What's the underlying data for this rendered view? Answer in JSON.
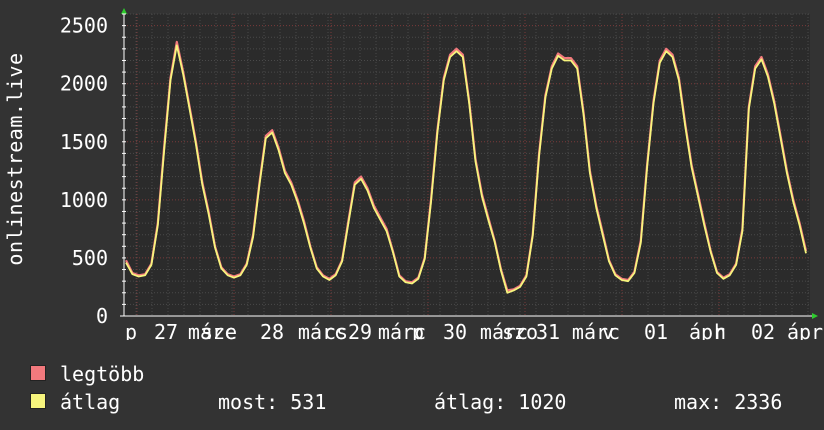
{
  "chart_data": {
    "type": "line",
    "ylabel": "onlinestream.live",
    "yticks": [
      0,
      500,
      1000,
      1500,
      2000,
      2500
    ],
    "ylim": [
      0,
      2600
    ],
    "x_tick_labels": [
      "p",
      "27",
      "márc",
      "sze",
      "28",
      "márc",
      "cs",
      "29",
      "márc",
      "p",
      "30",
      "márc",
      "szo",
      "31",
      "márc",
      "v",
      "01",
      "ápr",
      "h",
      "02",
      "ápr"
    ],
    "grid": true,
    "series": [
      {
        "name": "legtöbb",
        "color": "#f2797d",
        "values": [
          480,
          370,
          350,
          360,
          450,
          800,
          1450,
          2050,
          2360,
          2100,
          1800,
          1500,
          1150,
          900,
          600,
          420,
          360,
          340,
          360,
          450,
          700,
          1150,
          1550,
          1600,
          1450,
          1250,
          1150,
          1000,
          820,
          600,
          420,
          350,
          320,
          360,
          480,
          820,
          1150,
          1200,
          1100,
          950,
          850,
          750,
          560,
          350,
          300,
          290,
          330,
          500,
          1000,
          1600,
          2050,
          2250,
          2300,
          2250,
          1850,
          1350,
          1050,
          850,
          650,
          400,
          220,
          230,
          260,
          350,
          700,
          1400,
          1900,
          2150,
          2260,
          2220,
          2220,
          2150,
          1750,
          1250,
          950,
          720,
          480,
          360,
          320,
          310,
          380,
          650,
          1300,
          1850,
          2200,
          2300,
          2250,
          2050,
          1650,
          1300,
          1050,
          800,
          560,
          380,
          330,
          360,
          450,
          750,
          1800,
          2150,
          2230,
          2080,
          1850,
          1550,
          1250,
          1000,
          800,
          560
        ]
      },
      {
        "name": "átlag",
        "color": "#f7f57d",
        "values": [
          460,
          360,
          340,
          350,
          440,
          780,
          1420,
          2030,
          2330,
          2080,
          1780,
          1480,
          1130,
          880,
          590,
          410,
          350,
          330,
          350,
          440,
          680,
          1130,
          1530,
          1580,
          1430,
          1230,
          1130,
          980,
          800,
          590,
          410,
          340,
          310,
          350,
          470,
          800,
          1130,
          1180,
          1080,
          930,
          830,
          730,
          550,
          340,
          290,
          280,
          320,
          490,
          980,
          1580,
          2030,
          2230,
          2280,
          2230,
          1830,
          1330,
          1030,
          830,
          640,
          390,
          200,
          220,
          250,
          340,
          690,
          1380,
          1880,
          2130,
          2240,
          2200,
          2200,
          2130,
          1730,
          1230,
          930,
          700,
          470,
          350,
          310,
          300,
          370,
          630,
          1280,
          1830,
          2180,
          2280,
          2230,
          2030,
          1630,
          1280,
          1030,
          780,
          550,
          370,
          320,
          350,
          440,
          730,
          1780,
          2130,
          2210,
          2060,
          1830,
          1530,
          1230,
          980,
          780,
          540
        ]
      }
    ]
  },
  "legend": [
    {
      "label": "legtöbb",
      "color": "#f2797d"
    },
    {
      "label": "átlag",
      "color": "#f7f57d"
    }
  ],
  "stats": {
    "most": "most: 531",
    "atlag": "átlag: 1020",
    "max": "max: 2336"
  }
}
